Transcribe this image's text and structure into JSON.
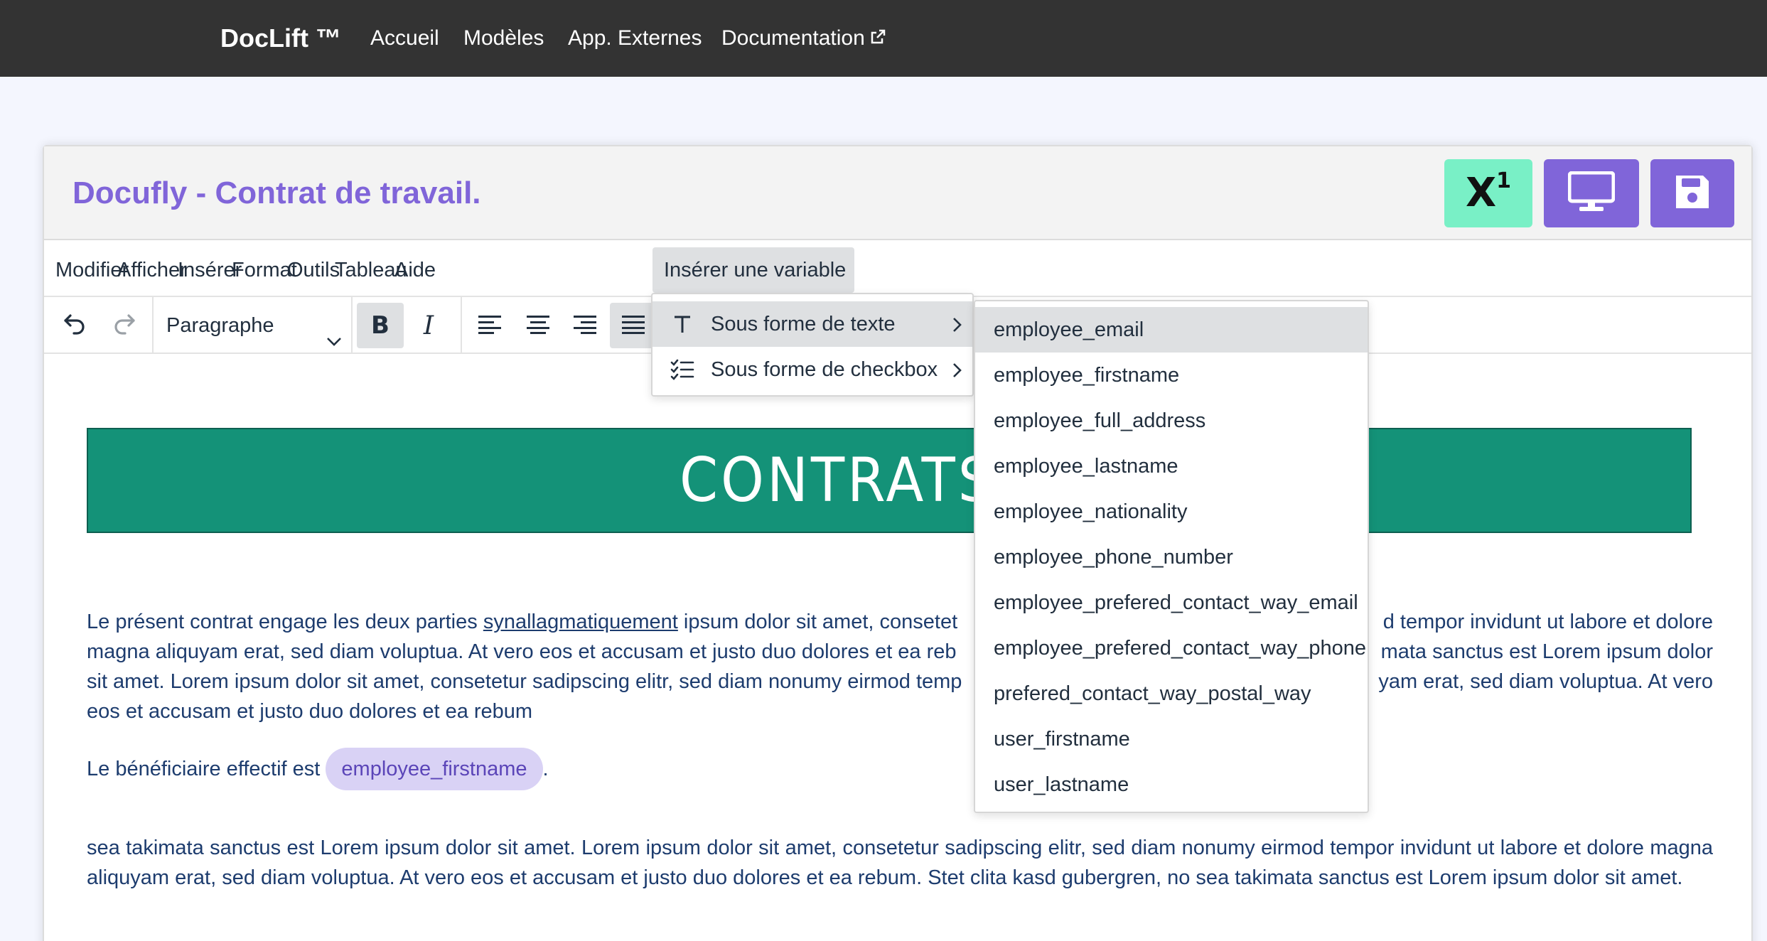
{
  "navbar": {
    "brand": "DocLift ™",
    "links": [
      "Accueil",
      "Modèles",
      "App. Externes",
      "Documentation"
    ]
  },
  "header": {
    "title": "Docufly - Contrat de travail.",
    "superscript_label": "x¹"
  },
  "menubar": [
    "Modifier",
    "Afficher",
    "Insérer",
    "Format",
    "Outils",
    "Tableau",
    "Aide",
    "Insérer une variable"
  ],
  "toolbar": {
    "block_format": "Paragraphe"
  },
  "insert_variable_menu": {
    "items": [
      "Sous forme de texte",
      "Sous forme de checkbox"
    ]
  },
  "variables": [
    "employee_email",
    "employee_firstname",
    "employee_full_address",
    "employee_lastname",
    "employee_nationality",
    "employee_phone_number",
    "employee_prefered_contact_way_email",
    "employee_prefered_contact_way_phone",
    "prefered_contact_way_postal_way",
    "user_firstname",
    "user_lastname"
  ],
  "content": {
    "banner": "CONTRATS DE",
    "p1_before": "Le présent contrat engage les deux parties ",
    "p1_link": "synallagmatiquement",
    "p1_mid": " ipsum dolor sit amet, consetet",
    "p1_after": "d tempor invidunt ut labore et dolore",
    "p1_l2a": "magna aliquyam erat, sed diam voluptua. At vero eos et accusam et justo duo dolores et ea reb",
    "p1_l2b": "mata sanctus est Lorem ipsum dolor",
    "p1_l3a": "sit amet. Lorem ipsum dolor sit amet, consetetur sadipscing elitr, sed diam nonumy eirmod temp",
    "p1_l3b": "yam erat, sed diam voluptua. At vero",
    "p1_l4": "eos et accusam et justo duo dolores et ea rebum",
    "p2_before": "Le bénéficiaire effectif est",
    "p2_var": "employee_firstname",
    "p2_after": ".",
    "p3": "sea takimata sanctus est Lorem ipsum dolor sit amet. Lorem ipsum dolor sit amet, consetetur sadipscing elitr, sed diam nonumy eirmod tempor invidunt ut labore et dolore magna aliquyam erat, sed diam voluptua. At vero eos et accusam et justo duo dolores et ea rebum. Stet clita kasd gubergren, no sea takimata sanctus est Lorem ipsum dolor sit amet."
  },
  "colors": {
    "navbar": "#333333",
    "accent_purple": "#8065d9",
    "accent_mint": "#79f0c6",
    "banner_green": "#149278",
    "text_blue": "#1d3c6e"
  }
}
